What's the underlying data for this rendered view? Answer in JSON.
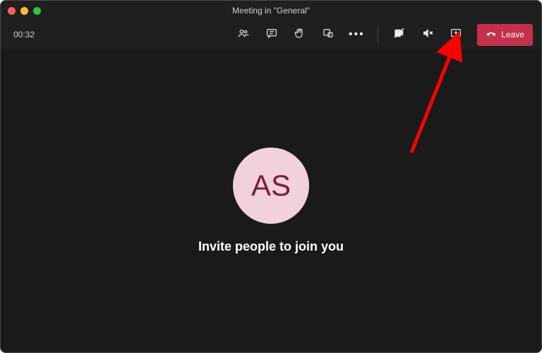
{
  "window": {
    "title": "Meeting in \"General\""
  },
  "toolbar": {
    "timer": "00:32",
    "leave_label": "Leave"
  },
  "avatar": {
    "initials": "AS"
  },
  "main": {
    "invite_text": "Invite people to join you"
  },
  "colors": {
    "leave_button": "#c4314b",
    "avatar_bg": "#f1d1db",
    "avatar_fg": "#7c1e3a",
    "annotation_arrow": "#ff0000"
  }
}
